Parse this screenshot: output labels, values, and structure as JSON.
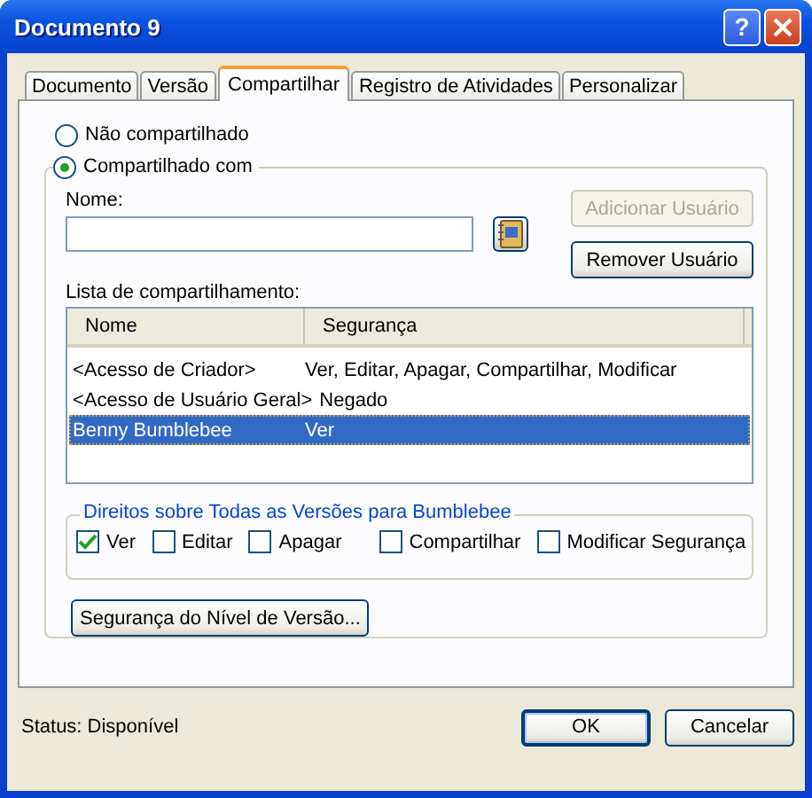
{
  "window": {
    "title": "Documento 9",
    "help_button": "?"
  },
  "tabs": [
    {
      "label": "Documento",
      "selected": false
    },
    {
      "label": "Versão",
      "selected": false
    },
    {
      "label": "Compartilhar",
      "selected": true
    },
    {
      "label": "Registro de Atividades",
      "selected": false
    },
    {
      "label": "Personalizar",
      "selected": false
    }
  ],
  "sharing_options": [
    {
      "label": "Não compartilhado",
      "selected": false
    },
    {
      "label": "Compartilhado com",
      "selected": true
    }
  ],
  "name_field": {
    "label": "Nome:"
  },
  "add_user_button": {
    "label": "Adicionar Usuário",
    "disabled": true
  },
  "remove_user_button": {
    "label": "Remover Usuário",
    "disabled": false
  },
  "share_list": {
    "label": "Lista de compartilhamento:",
    "columns": [
      "Nome",
      "Segurança"
    ],
    "rows": [
      {
        "cells": [
          "<Acesso de Criador>",
          "Ver, Editar, Apagar, Compartilhar, Modificar"
        ],
        "selected": false
      },
      {
        "cells": [
          "<Acesso de Usuário Geral>",
          "Negado"
        ],
        "selected": false
      },
      {
        "cells": [
          "Benny Bumblebee",
          "Ver"
        ],
        "selected": true
      }
    ]
  },
  "rights": {
    "title": "Direitos sobre Todas as Versões para Bumblebee",
    "options": [
      {
        "label": "Ver",
        "checked": true
      },
      {
        "label": "Editar",
        "checked": false
      },
      {
        "label": "Apagar",
        "checked": false
      },
      {
        "label": "Compartilhar",
        "checked": false
      },
      {
        "label": "Modificar Segurança",
        "checked": false
      }
    ]
  },
  "version_security_button": {
    "label": "Segurança do Nível de Versão..."
  },
  "status": "Status: Disponível",
  "footer_buttons": [
    {
      "label": "OK",
      "default": true
    },
    {
      "label": "Cancelar",
      "default": false
    }
  ]
}
